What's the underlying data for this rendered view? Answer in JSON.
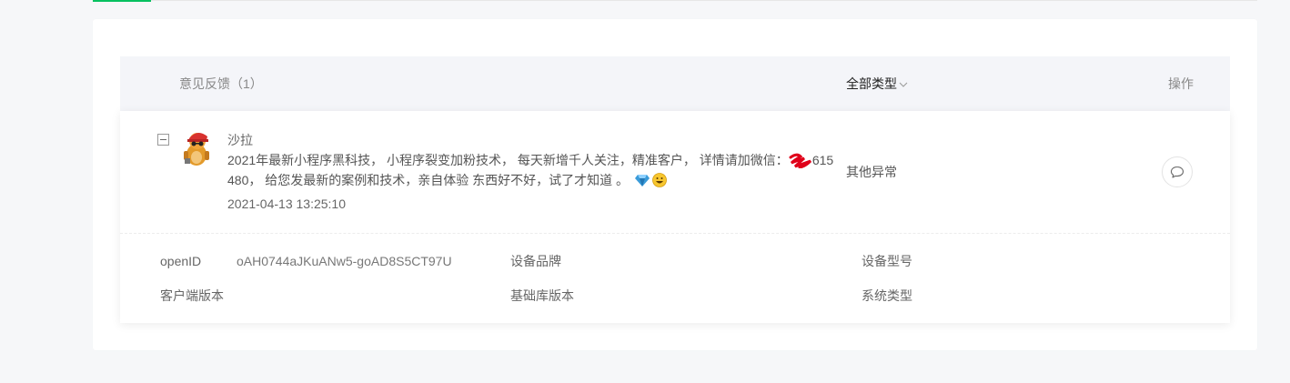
{
  "table_header": {
    "feedback_label": "意见反馈（1）",
    "type_filter_label": "全部类型",
    "action_label": "操作"
  },
  "feedback": {
    "user_name": "沙拉",
    "text_part1": "2021年最新小程序黑科技， 小程序裂变加粉技术， 每天新增千人关注，精准客户， 详情请加微信：",
    "text_part2": "615 480， 给您发最新的案例和技术，亲自体验 东西好不好，试了才知道 。",
    "timestamp": "2021-04-13 13:25:10",
    "type": "其他异常"
  },
  "details": {
    "openid_label": "openID",
    "openid_value": "oAH0744aJKuANw5-goAD8S5CT97U",
    "brand_label": "设备品牌",
    "model_label": "设备型号",
    "client_version_label": "客户端版本",
    "lib_version_label": "基础库版本",
    "system_type_label": "系统类型"
  },
  "colors": {
    "accent": "#07c160",
    "header_bg": "#f4f5f9",
    "page_bg": "#f6f7f9",
    "redaction": "#e0001a"
  },
  "icons": {
    "collapse": "minus-square-icon",
    "type_filter": "chevron-down-icon",
    "reply": "comment-icon",
    "emoji_1": "gem-icon",
    "emoji_2": "grinning-face-icon"
  }
}
